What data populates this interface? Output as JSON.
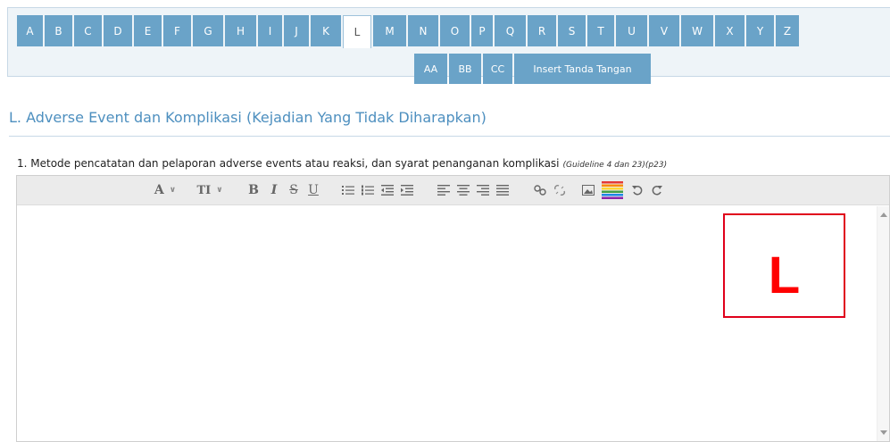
{
  "tabs_row1": [
    {
      "label": "A"
    },
    {
      "label": "B"
    },
    {
      "label": "C"
    },
    {
      "label": "D"
    },
    {
      "label": "E"
    },
    {
      "label": "F"
    },
    {
      "label": "G"
    },
    {
      "label": "H"
    },
    {
      "label": "I"
    },
    {
      "label": "J"
    },
    {
      "label": "K"
    },
    {
      "label": "L",
      "active": true
    },
    {
      "label": "M"
    },
    {
      "label": "N"
    },
    {
      "label": "O"
    },
    {
      "label": "P"
    },
    {
      "label": "Q"
    },
    {
      "label": "R"
    },
    {
      "label": "S"
    },
    {
      "label": "T"
    },
    {
      "label": "U"
    },
    {
      "label": "V"
    },
    {
      "label": "W"
    },
    {
      "label": "X"
    },
    {
      "label": "Y"
    },
    {
      "label": "Z"
    }
  ],
  "tabs_row2": [
    {
      "label": "AA"
    },
    {
      "label": "BB"
    },
    {
      "label": "CC"
    },
    {
      "label": "Insert Tanda Tangan"
    }
  ],
  "section": {
    "title": "L. Adverse Event dan Komplikasi (Kejadian Yang Tidak Diharapkan)"
  },
  "question": {
    "text": "1. Metode pencatatan dan pelaporan adverse events atau reaksi, dan syarat penanganan komplikasi",
    "reference": "(Guideline 4 dan 23)(p23)"
  },
  "toolbar": {
    "font_label": "A",
    "size_label": "TI",
    "bold": "B",
    "italic": "I",
    "strike": "S",
    "underline": "U",
    "icons": [
      "unordered-list-icon",
      "ordered-list-icon",
      "outdent-icon",
      "indent-icon",
      "align-left-icon",
      "align-center-icon",
      "align-right-icon",
      "justify-icon",
      "link-icon",
      "unlink-icon",
      "image-icon",
      "color-icon",
      "undo-icon",
      "redo-icon"
    ]
  },
  "overlay": {
    "letter": "L",
    "color": "#ff0000"
  },
  "colors": {
    "tab": "#6aa3c8",
    "title": "#4d8fbf"
  }
}
